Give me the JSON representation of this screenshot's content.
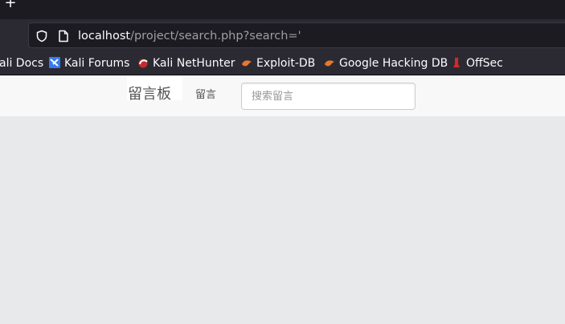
{
  "browser": {
    "new_tab": "+",
    "url_host": "localhost",
    "url_path": "/project/search.php?search='"
  },
  "bookmarks": [
    {
      "label": "ali Docs",
      "icon": "kali-docs-icon"
    },
    {
      "label": "Kali Forums",
      "icon": "kali-forums-icon"
    },
    {
      "label": "Kali NetHunter",
      "icon": "kali-nethunter-icon"
    },
    {
      "label": "Exploit-DB",
      "icon": "exploit-db-icon"
    },
    {
      "label": "Google Hacking DB",
      "icon": "google-hacking-db-icon"
    },
    {
      "label": "OffSec",
      "icon": "offsec-icon"
    }
  ],
  "navbar": {
    "brand": "留言板",
    "link": "留言",
    "search_placeholder": "搜索留言"
  }
}
